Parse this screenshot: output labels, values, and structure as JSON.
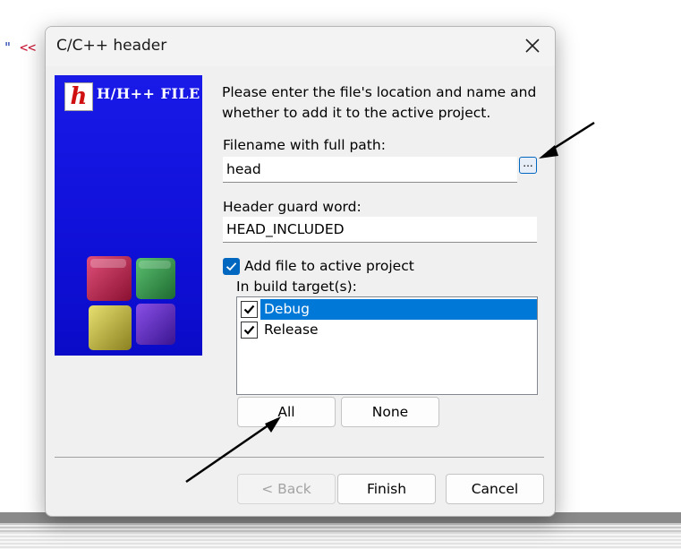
{
  "background": {
    "code_fragment": "\"",
    "code_operator": "<<"
  },
  "dialog": {
    "title": "C/C++ header",
    "close_icon": "close-icon",
    "logo": {
      "letter": "h",
      "text": "H/H++ FILE"
    },
    "intro_text": "Please enter the file's location and name and whether to add it to the active project.",
    "filename": {
      "label": "Filename with full path:",
      "value": "head",
      "browse_label": "..."
    },
    "guard": {
      "label": "Header guard word:",
      "value": "HEAD_INCLUDED"
    },
    "add_to_project": {
      "label": "Add file to active project",
      "checked": true
    },
    "targets": {
      "label": "In build target(s):",
      "items": [
        {
          "label": "Debug",
          "checked": true,
          "selected": true
        },
        {
          "label": "Release",
          "checked": true,
          "selected": false
        }
      ],
      "all_label": "All",
      "none_label": "None"
    },
    "buttons": {
      "back": "< Back",
      "finish": "Finish",
      "cancel": "Cancel"
    }
  },
  "colors": {
    "accent": "#0067c0",
    "selection": "#0078d7",
    "logo_background": "#1010e0"
  }
}
